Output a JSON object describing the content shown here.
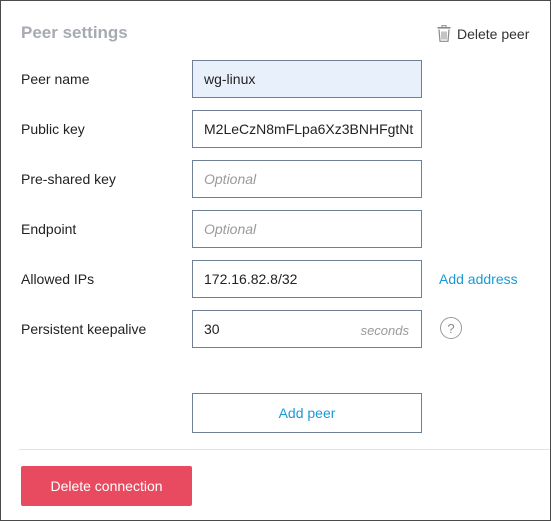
{
  "section_title": "Peer settings",
  "delete_peer": {
    "label": "Delete peer",
    "icon": "trash-icon"
  },
  "fields": {
    "peer_name": {
      "label": "Peer name",
      "value": "wg-linux"
    },
    "public_key": {
      "label": "Public key",
      "value": "M2LeCzN8mFLpa6Xz3BNHFgtNt"
    },
    "preshared_key": {
      "label": "Pre-shared key",
      "value": "",
      "placeholder": "Optional"
    },
    "endpoint": {
      "label": "Endpoint",
      "value": "",
      "placeholder": "Optional"
    },
    "allowed_ips": {
      "label": "Allowed IPs",
      "value": "172.16.82.8/32",
      "action": "Add address"
    },
    "keepalive": {
      "label": "Persistent keepalive",
      "value": "30",
      "unit": "seconds",
      "help": "?"
    }
  },
  "add_peer_label": "Add peer",
  "delete_connection_label": "Delete connection",
  "colors": {
    "accent_link": "#1a9ad6",
    "danger": "#e84a5f",
    "title_gray": "#a6aab3",
    "filled_field_bg": "#e8f0fb"
  }
}
